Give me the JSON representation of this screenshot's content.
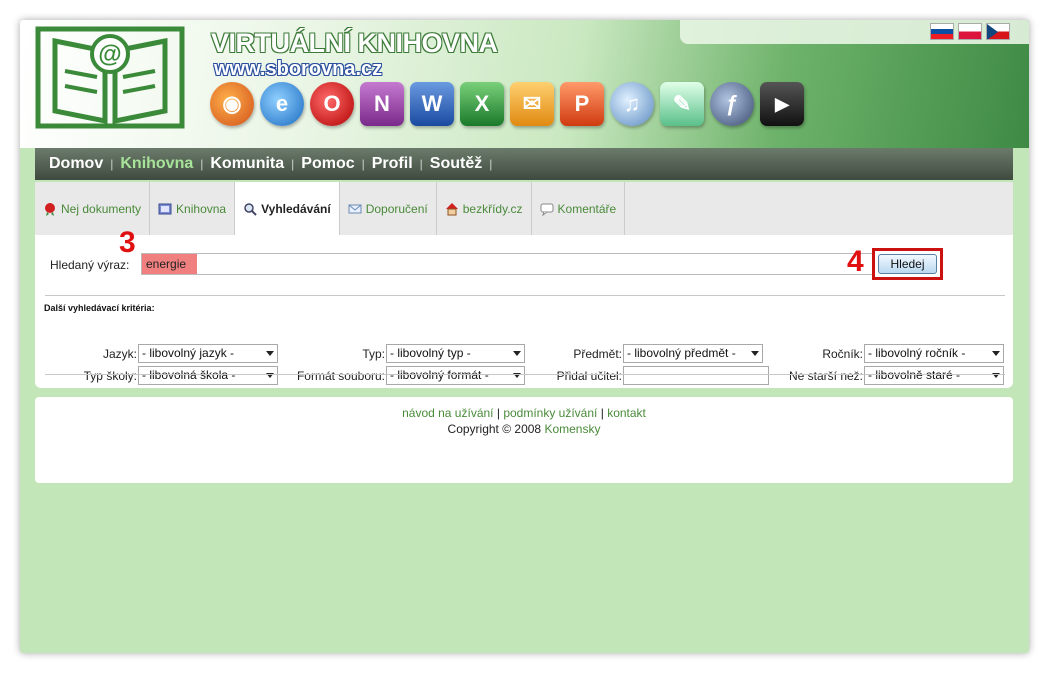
{
  "header": {
    "title": "VIRTUÁLNÍ KNIHOVNA",
    "url": "www.sborovna.cz",
    "apps": [
      "firefox-icon",
      "ie-icon",
      "opera-icon",
      "onenote-icon",
      "word-icon",
      "excel-icon",
      "outlook-icon",
      "powerpoint-icon",
      "itunes-icon",
      "feather-icon",
      "flash-icon",
      "avi-icon"
    ],
    "flags": [
      "slovak-flag",
      "polish-flag",
      "czech-flag"
    ]
  },
  "nav": {
    "items": [
      {
        "label": "Domov",
        "active": false
      },
      {
        "label": "Knihovna",
        "active": true
      },
      {
        "label": "Komunita",
        "active": false
      },
      {
        "label": "Pomoc",
        "active": false
      },
      {
        "label": "Profil",
        "active": false
      },
      {
        "label": "Soutěž",
        "active": false
      }
    ],
    "separator": "|"
  },
  "tabs": [
    {
      "label": "Nej dokumenty",
      "icon": "rosette-icon",
      "active": false
    },
    {
      "label": "Knihovna",
      "icon": "book-icon",
      "active": false
    },
    {
      "label": "Vyhledávání",
      "icon": "magnifier-icon",
      "active": true
    },
    {
      "label": "Doporučení",
      "icon": "envelope-icon",
      "active": false
    },
    {
      "label": "bezkřídy.cz",
      "icon": "house-icon",
      "active": false
    },
    {
      "label": "Komentáře",
      "icon": "speech-bubble-icon",
      "active": false
    }
  ],
  "search": {
    "label": "Hledaný výraz:",
    "value": "energie",
    "button": "Hledej",
    "step_a": "3",
    "step_b": "4"
  },
  "criteria": {
    "title": "Další vyhledávací kritéria:",
    "jazyk": {
      "label": "Jazyk:",
      "value": "- libovolný jazyk -"
    },
    "typ": {
      "label": "Typ:",
      "value": "- libovolný typ -"
    },
    "predmet": {
      "label": "Předmět:",
      "value": "- libovolný předmět -"
    },
    "rocnik": {
      "label": "Ročník:",
      "value": "- libovolný ročník -"
    },
    "typ_skoly": {
      "label": "Typ školy:",
      "value": "- libovolná škola -"
    },
    "format": {
      "label": "Formát souboru:",
      "value": "- libovolný formát -"
    },
    "pridal": {
      "label": "Přidal učitel:",
      "value": ""
    },
    "nestarsi": {
      "label": "Ne starší než:",
      "value": "- libovolně staré -"
    }
  },
  "footer": {
    "link1": "návod na užívání",
    "sep": "|",
    "link2": "podmínky užívání",
    "link3": "kontakt",
    "copyright": "Copyright © 2008",
    "company": "Komensky"
  }
}
